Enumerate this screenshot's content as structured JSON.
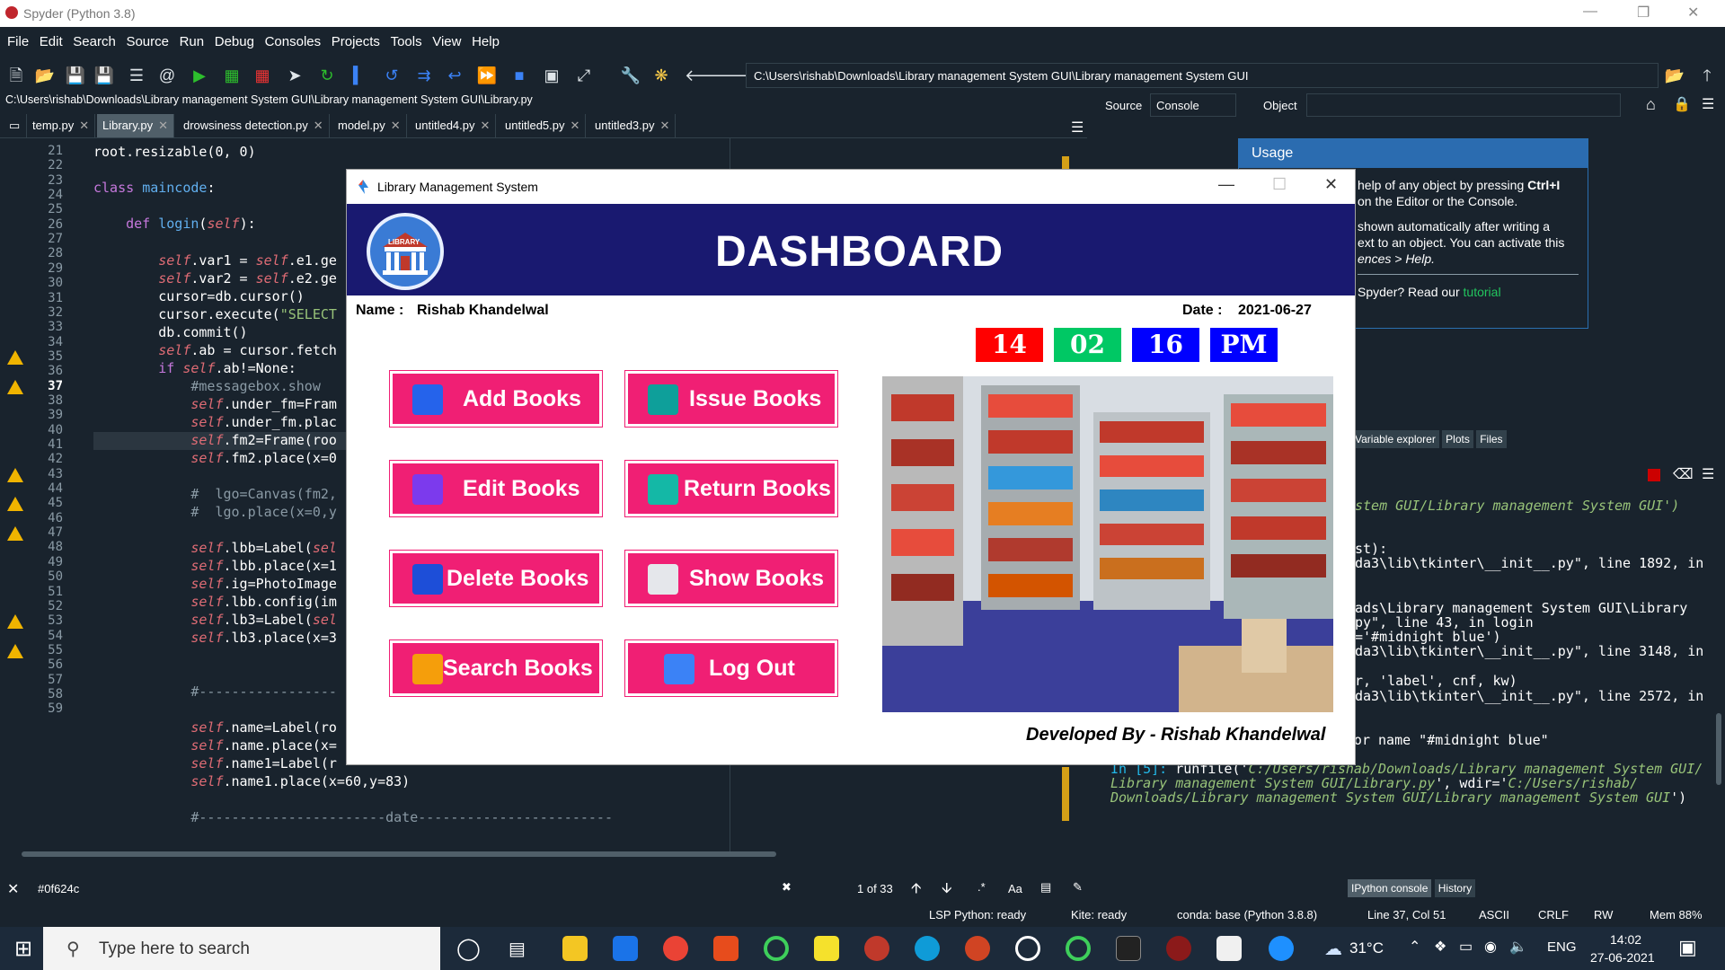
{
  "app": {
    "title": "Spyder (Python 3.8)"
  },
  "menu": [
    "File",
    "Edit",
    "Search",
    "Source",
    "Run",
    "Debug",
    "Consoles",
    "Projects",
    "Tools",
    "View",
    "Help"
  ],
  "toolbar": {
    "path": "C:\\Users\\rishab\\Downloads\\Library management System GUI\\Library management System GUI"
  },
  "editor": {
    "file_path": "C:\\Users\\rishab\\Downloads\\Library management System GUI\\Library management System GUI\\Library.py",
    "tabs": [
      {
        "label": "temp.py"
      },
      {
        "label": "Library.py",
        "active": true
      },
      {
        "label": "drowsiness detection.py"
      },
      {
        "label": "model.py"
      },
      {
        "label": "untitled4.py"
      },
      {
        "label": "untitled5.py"
      },
      {
        "label": "untitled3.py"
      }
    ],
    "current_line": "37",
    "line_numbers": [
      "21",
      "22",
      "23",
      "24",
      "25",
      "26",
      "27",
      "28",
      "29",
      "30",
      "31",
      "32",
      "33",
      "34",
      "35",
      "36",
      "37",
      "38",
      "39",
      "40",
      "41",
      "42",
      "43",
      "44",
      "45",
      "46",
      "47",
      "48",
      "49",
      "50",
      "51",
      "52",
      "53",
      "54",
      "55",
      "56",
      "57",
      "58",
      "59"
    ],
    "warning_lines": [
      "35",
      "37",
      "43",
      "45",
      "47",
      "53",
      "55"
    ]
  },
  "find": {
    "query": "#0f624c",
    "count": "1 of 33",
    "case_label": "Aa"
  },
  "rightpane": {
    "source_label": "Source",
    "source_value": "Console",
    "object_label": "Object",
    "usage_title": "Usage",
    "usage_line1": "help of any object by pressing ",
    "usage_key": "Ctrl+I",
    "usage_line2": " on the Editor or the Console.",
    "usage_line3": "shown automatically after writing a",
    "usage_line4": "ext to an object. You can activate this",
    "usage_line5": "ences > Help.",
    "usage_line6": " Spyder? Read our ",
    "usage_link": "tutorial",
    "pane_tabs": [
      "Variable explorer",
      "Plots",
      "Files"
    ],
    "console_tabs": [
      "IPython console",
      "History"
    ]
  },
  "console": {
    "lines": [
      "stem GUI/Library management System GUI')",
      "st):",
      "da3\\lib\\tkinter\\__init__.py\", line 1892, in",
      "ads\\Library management System GUI\\Library",
      "py\", line 43, in login",
      "='#midnight blue')",
      "da3\\lib\\tkinter\\__init__.py\", line 3148, in",
      "r, 'label', cnf, kw)",
      "da3\\lib\\tkinter\\__init__.py\", line 2572, in"
    ],
    "error": "_tkinter.TclError: invalid color name \"#midnight blue\"",
    "prompt": "In [5]: ",
    "run1": "runfile('",
    "run_path1": "C:/Users/rishab/Downloads/Library management System GUI/",
    "run_path2": "Library management System GUI/Library.py",
    "run_mid": "', wdir='",
    "run_path3": "C:/Users/rishab/",
    "run_path4": "Downloads/Library management System GUI/Library management System GUI",
    "run_end": "')"
  },
  "status": {
    "lsp": "LSP Python: ready",
    "kite": "Kite: ready",
    "conda": "conda: base (Python 3.8.8)",
    "position": "Line 37, Col 51",
    "encoding": "ASCII",
    "eol": "CRLF",
    "rw": "RW",
    "mem": "Mem 88%"
  },
  "taskbar": {
    "search_placeholder": "Type here to search",
    "weather": "31°C",
    "lang": "ENG",
    "time": "14:02",
    "date": "27-06-2021"
  },
  "tk": {
    "title": "Library Management System",
    "heading": "DASHBOARD",
    "logo_text": "LIBRARY",
    "name_label": "Name :",
    "name_value": "Rishab Khandelwal",
    "date_label": "Date :",
    "date_value": "2021-06-27",
    "clock": {
      "hour": "14",
      "minute": "02",
      "second": "16",
      "ampm": "PM"
    },
    "clock_colors": {
      "hour": "#ff0000",
      "minute": "#00c864",
      "second": "#0000ff",
      "ampm": "#0000ff"
    },
    "buttons": [
      "Add Books",
      "Issue Books",
      "Edit Books",
      "Return Books",
      "Delete Books",
      "Show Books",
      "Search Books",
      "Log Out"
    ],
    "button_color": "#f01f74",
    "header_color": "#191970",
    "developer": "Developed By - Rishab Khandelwal"
  }
}
